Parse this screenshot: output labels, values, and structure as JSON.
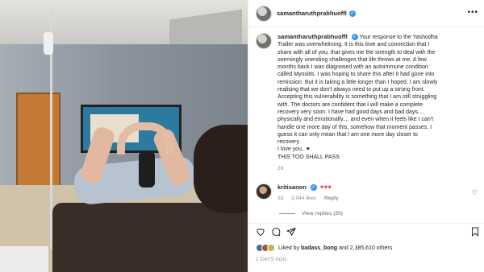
{
  "post": {
    "username": "samantharuthprabhuoffl",
    "verified_glyph": "✓",
    "more_glyph": "•••"
  },
  "caption": {
    "username": "samantharuthprabhuoffl",
    "lines": [
      "Your response to the Yashodha",
      "Trailer was overwhelming. It is this love and connection that I",
      "share with all of you, that gives me the strength to deal with the",
      "seemingly unending challenges that life throws at me. A few",
      "months back I was diagnosed with an autoimmune condition",
      "called Myositis. I was hoping to share this after it had gone into",
      "remission. But it is taking a little longer than I hoped. I am slowly",
      "realising that we don't always need to put up a strong front.",
      "Accepting this vulnerability is something that I am still struggling",
      "with. The doctors are confident that I will make a complete",
      "recovery very soon. I have had good days and bad days....",
      "physically and emotionally.... and even when it feels like I can't",
      "handle one more day of this, somehow that moment passes. I",
      "guess it can only mean that I am one more day closer to",
      "recovery.",
      "I love you.. ♥",
      "THIS TOO SHALL PASS"
    ],
    "time": "2d"
  },
  "comment": {
    "username": "kritisanon",
    "hearts": "♥♥♥",
    "time": "2d",
    "likes": "3,944 likes",
    "reply_label": "Reply"
  },
  "view_replies": "View replies (20)",
  "likes": {
    "prefix": "Liked by ",
    "user": "badass_bong",
    "suffix": " and 2,385,610 others"
  },
  "date": "2 DAYS AGO",
  "icons": [
    "heart-icon",
    "comment-icon",
    "share-icon",
    "bookmark-icon",
    "more-icon",
    "verified-icon"
  ]
}
